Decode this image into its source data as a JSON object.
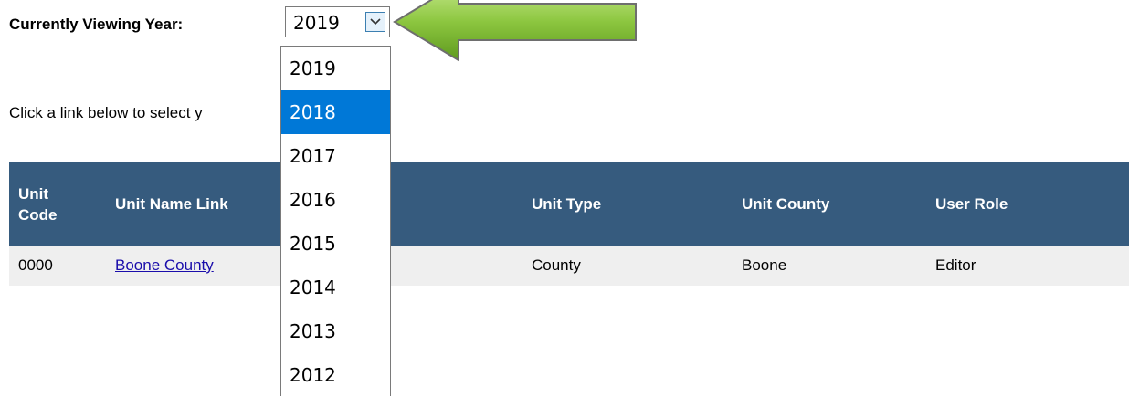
{
  "year_picker": {
    "label": "Currently Viewing Year:",
    "selected": "2019",
    "options": [
      "2019",
      "2018",
      "2017",
      "2016",
      "2015",
      "2014",
      "2013",
      "2012"
    ],
    "highlighted": "2018"
  },
  "instruction": "Click a link below to select y",
  "table": {
    "headers": [
      "Unit\nCode",
      "Unit Name Link",
      "Unit Type",
      "Unit County",
      "User Role"
    ],
    "rows": [
      {
        "code": "0000",
        "name": "Boone County",
        "type": "County",
        "county": "Boone",
        "role": "Editor"
      }
    ]
  },
  "colors": {
    "header_bg": "#365b7e",
    "row_bg": "#efefef",
    "highlight": "#0078d7",
    "arrow_green": "#8cc63f"
  }
}
